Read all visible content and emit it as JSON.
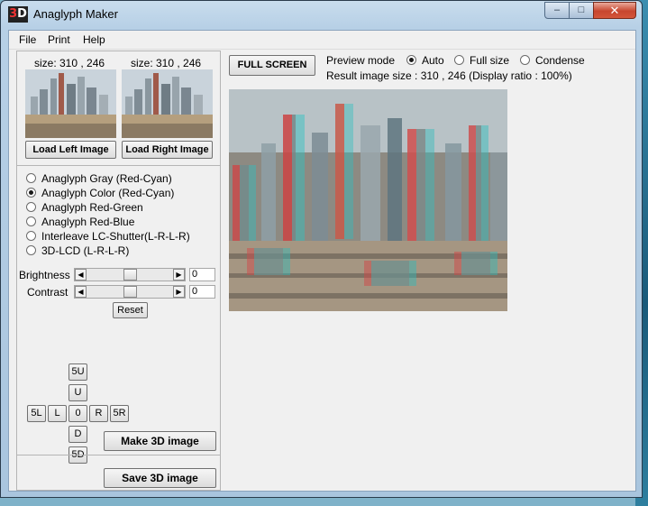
{
  "window": {
    "icon_text": "3D",
    "title": "Anaglyph Maker",
    "controls": {
      "minimize": "–",
      "maximize": "□",
      "close": "✕"
    }
  },
  "menu": [
    "File",
    "Print",
    "Help"
  ],
  "left_panel": {
    "left_size_label": "size: 310 , 246",
    "right_size_label": "size: 310 , 246",
    "load_left_label": "Load Left Image",
    "load_right_label": "Load Right Image",
    "modes": [
      {
        "label": "Anaglyph Gray (Red-Cyan)",
        "selected": false
      },
      {
        "label": "Anaglyph Color (Red-Cyan)",
        "selected": true
      },
      {
        "label": "Anaglyph Red-Green",
        "selected": false
      },
      {
        "label": "Anaglyph Red-Blue",
        "selected": false
      },
      {
        "label": "Interleave LC-Shutter(L-R-L-R)",
        "selected": false
      },
      {
        "label": "3D-LCD (L-R-L-R)",
        "selected": false
      }
    ],
    "brightness": {
      "label": "Brightness",
      "value": "0"
    },
    "contrast": {
      "label": "Contrast",
      "value": "0"
    },
    "reset_label": "Reset",
    "shift": {
      "5u": "5U",
      "u": "U",
      "5l": "5L",
      "l": "L",
      "zero": "0",
      "r": "R",
      "5r": "5R",
      "d": "D",
      "5d": "5D"
    },
    "make_label": "Make 3D image",
    "save_label": "Save 3D image"
  },
  "preview": {
    "full_screen_label": "FULL SCREEN",
    "mode_label": "Preview mode",
    "options": [
      {
        "label": "Auto",
        "selected": true
      },
      {
        "label": "Full size",
        "selected": false
      },
      {
        "label": "Condense",
        "selected": false
      }
    ],
    "result_text": "Result image size :  310 , 246  (Display ratio : 100%)"
  },
  "colors": {
    "accent_red": "#e33333",
    "accent_cyan": "#1fc8c8",
    "window_border": "#2a3b4c"
  },
  "icons": {
    "app": "anaglyph-3d-icon"
  }
}
